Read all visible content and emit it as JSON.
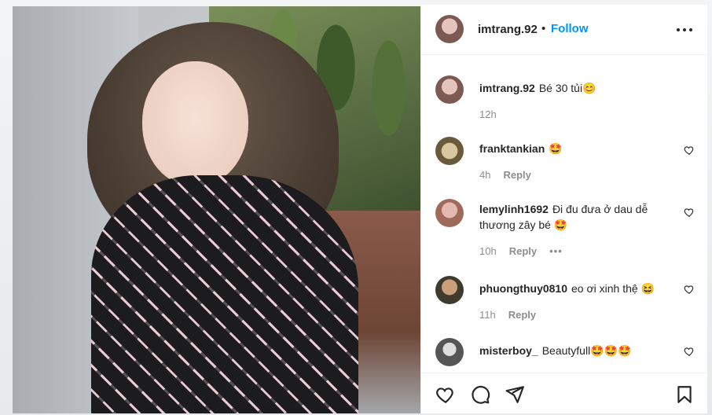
{
  "post": {
    "username": "imtrang.92",
    "separator": "•",
    "follow_label": "Follow"
  },
  "comments": [
    {
      "username": "imtrang.92",
      "text": "Bé 30 tủi",
      "emoji": "😊",
      "time": "12h",
      "reply": ""
    },
    {
      "username": "franktankian",
      "text": "",
      "emoji": "🤩",
      "time": "4h",
      "reply": "Reply"
    },
    {
      "username": "lemylinh1692",
      "text": "Đi đu đưa ở dau dễ thương zây bé",
      "emoji": "🤩",
      "time": "10h",
      "reply": "Reply",
      "more": "•••"
    },
    {
      "username": "phuongthuy0810",
      "text": "eo ơi xinh thệ",
      "emoji": "😆",
      "time": "11h",
      "reply": "Reply"
    },
    {
      "username": "misterboy_",
      "text": "Beautyfull",
      "emoji": "🤩🤩🤩",
      "time": "",
      "reply": ""
    }
  ],
  "icons": {
    "more": "more-options-icon",
    "like": "heart-icon",
    "comment": "comment-icon",
    "share": "share-icon",
    "save": "bookmark-icon"
  },
  "colors": {
    "accent": "#0095f6",
    "text": "#262626",
    "muted": "#8e8e8e"
  }
}
